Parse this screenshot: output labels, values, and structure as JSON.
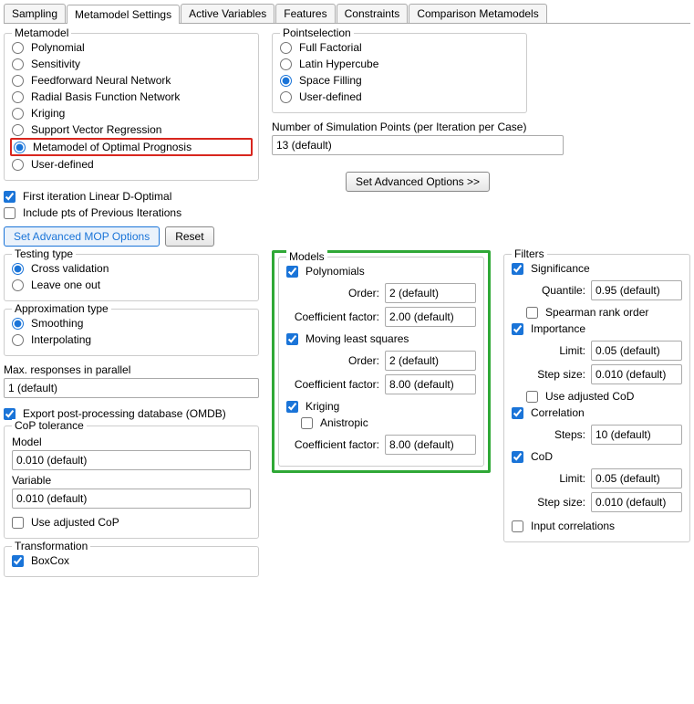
{
  "tabs": [
    "Sampling",
    "Metamodel Settings",
    "Active Variables",
    "Features",
    "Constraints",
    "Comparison Metamodels"
  ],
  "metamodel": {
    "legend": "Metamodel",
    "options": [
      "Polynomial",
      "Sensitivity",
      "Feedforward Neural Network",
      "Radial Basis Function Network",
      "Kriging",
      "Support Vector Regression",
      "Metamodel of Optimal Prognosis",
      "User-defined"
    ],
    "selected": "Metamodel of Optimal Prognosis",
    "firstIter": "First iteration Linear D-Optimal",
    "includePts": "Include pts of Previous Iterations",
    "btnMOP": "Set Advanced MOP Options",
    "btnReset": "Reset"
  },
  "pointselection": {
    "legend": "Pointselection",
    "options": [
      "Full Factorial",
      "Latin Hypercube",
      "Space Filling",
      "User-defined"
    ],
    "selected": "Space Filling",
    "numLabel": "Number of Simulation Points (per Iteration per Case)",
    "numValue": "13 (default)",
    "btnAdvanced": "Set Advanced Options >>"
  },
  "testing": {
    "legend": "Testing type",
    "options": [
      "Cross validation",
      "Leave one out"
    ],
    "selected": "Cross validation"
  },
  "approx": {
    "legend": "Approximation type",
    "options": [
      "Smoothing",
      "Interpolating"
    ],
    "selected": "Smoothing"
  },
  "maxResp": {
    "label": "Max. responses in parallel",
    "value": "1 (default)"
  },
  "exportOMDB": "Export post-processing database (OMDB)",
  "copTol": {
    "legend": "CoP tolerance",
    "modelLabel": "Model",
    "modelValue": "0.010 (default)",
    "varLabel": "Variable",
    "varValue": "0.010 (default)",
    "useAdjusted": "Use adjusted CoP"
  },
  "transform": {
    "legend": "Transformation",
    "boxcox": "BoxCox"
  },
  "models": {
    "legend": "Models",
    "poly": {
      "label": "Polynomials",
      "orderLabel": "Order:",
      "orderValue": "2 (default)",
      "coefLabel": "Coefficient factor:",
      "coefValue": "2.00 (default)"
    },
    "mls": {
      "label": "Moving least squares",
      "orderLabel": "Order:",
      "orderValue": "2 (default)",
      "coefLabel": "Coefficient factor:",
      "coefValue": "8.00 (default)"
    },
    "kriging": {
      "label": "Kriging",
      "aniso": "Anistropic",
      "coefLabel": "Coefficient factor:",
      "coefValue": "8.00 (default)"
    }
  },
  "filters": {
    "legend": "Filters",
    "sig": {
      "label": "Significance",
      "quantLabel": "Quantile:",
      "quantValue": "0.95 (default)",
      "spearman": "Spearman rank order"
    },
    "imp": {
      "label": "Importance",
      "limitLabel": "Limit:",
      "limitValue": "0.05 (default)",
      "stepLabel": "Step size:",
      "stepValue": "0.010 (default)",
      "useAdj": "Use adjusted CoD"
    },
    "corr": {
      "label": "Correlation",
      "stepsLabel": "Steps:",
      "stepsValue": "10 (default)"
    },
    "cod": {
      "label": "CoD",
      "limitLabel": "Limit:",
      "limitValue": "0.05 (default)",
      "stepLabel": "Step size:",
      "stepValue": "0.010 (default)"
    },
    "inputCorr": "Input correlations"
  }
}
